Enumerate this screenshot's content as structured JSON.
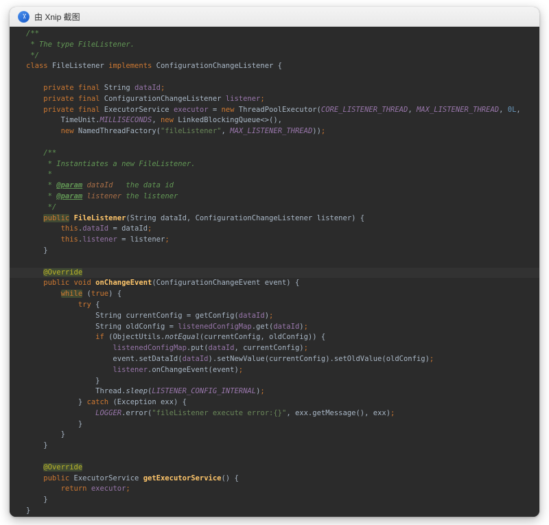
{
  "window": {
    "title": "由 Xnip 截图",
    "icon_glyph": "✂"
  },
  "theme": {
    "editor_background": "#2b2b2b",
    "titlebar_background": "#f4f4f4",
    "xnip_icon_blue": "#1659c8",
    "line_highlight": "#323232",
    "word_highlight": "#404a33",
    "default_text": "#a9b7c6",
    "keyword": "#cc7832",
    "string": "#6a8759",
    "number": "#6897bb",
    "comment": "#629755",
    "doc_tag_value": "#aa6f47",
    "field": "#9876aa",
    "method_decl": "#ffc66b",
    "annotation": "#bbb529"
  },
  "code": {
    "language": "java",
    "lines": [
      {
        "t": [
          [
            "c",
            "/**"
          ]
        ]
      },
      {
        "t": [
          [
            "c",
            " * The type FileListener."
          ]
        ]
      },
      {
        "t": [
          [
            "c",
            " */"
          ]
        ]
      },
      {
        "t": [
          [
            "k",
            "class"
          ],
          [
            "d",
            " FileListener "
          ],
          [
            "k",
            "implements"
          ],
          [
            "d",
            " ConfigurationChangeListener {"
          ]
        ]
      },
      {
        "t": []
      },
      {
        "t": [
          [
            "k",
            "    private final"
          ],
          [
            "d",
            " String "
          ],
          [
            "f",
            "dataId"
          ],
          [
            "k",
            ";"
          ]
        ]
      },
      {
        "t": [
          [
            "k",
            "    private final"
          ],
          [
            "d",
            " ConfigurationChangeListener "
          ],
          [
            "f",
            "listener"
          ],
          [
            "k",
            ";"
          ]
        ]
      },
      {
        "t": [
          [
            "k",
            "    private final"
          ],
          [
            "d",
            " ExecutorService "
          ],
          [
            "f",
            "executor"
          ],
          [
            "d",
            " = "
          ],
          [
            "k",
            "new"
          ],
          [
            "d",
            " ThreadPoolExecutor("
          ],
          [
            "sf",
            "CORE_LISTENER_THREAD"
          ],
          [
            "d",
            ", "
          ],
          [
            "sf",
            "MAX_LISTENER_THREAD"
          ],
          [
            "d",
            ", "
          ],
          [
            "n",
            "0L"
          ],
          [
            "d",
            ","
          ]
        ]
      },
      {
        "t": [
          [
            "d",
            "        TimeUnit."
          ],
          [
            "sf",
            "MILLISECONDS"
          ],
          [
            "d",
            ", "
          ],
          [
            "k",
            "new"
          ],
          [
            "d",
            " LinkedBlockingQueue<>(),"
          ]
        ]
      },
      {
        "t": [
          [
            "k",
            "        new"
          ],
          [
            "d",
            " NamedThreadFactory("
          ],
          [
            "s",
            "\"fileListener\""
          ],
          [
            "d",
            ", "
          ],
          [
            "sf",
            "MAX_LISTENER_THREAD"
          ],
          [
            "d",
            "))"
          ],
          [
            "k",
            ";"
          ]
        ]
      },
      {
        "t": []
      },
      {
        "t": [
          [
            "c",
            "    /**"
          ]
        ]
      },
      {
        "t": [
          [
            "c",
            "     * Instantiates a new FileListener."
          ]
        ]
      },
      {
        "t": [
          [
            "c",
            "     *"
          ]
        ]
      },
      {
        "t": [
          [
            "c",
            "     * "
          ],
          [
            "ct",
            "@param"
          ],
          [
            "c",
            " "
          ],
          [
            "cv",
            "dataId"
          ],
          [
            "c",
            "   the data id"
          ]
        ]
      },
      {
        "t": [
          [
            "c",
            "     * "
          ],
          [
            "ct",
            "@param"
          ],
          [
            "c",
            " "
          ],
          [
            "cv",
            "listener"
          ],
          [
            "c",
            " the listener"
          ]
        ]
      },
      {
        "t": [
          [
            "c",
            "     */"
          ]
        ]
      },
      {
        "t": [
          [
            "d",
            "    "
          ],
          [
            "k hl",
            "public"
          ],
          [
            "d",
            " "
          ],
          [
            "m",
            "FileListener"
          ],
          [
            "d",
            "(String dataId, ConfigurationChangeListener listener) {"
          ]
        ]
      },
      {
        "t": [
          [
            "k",
            "        this"
          ],
          [
            "d",
            "."
          ],
          [
            "f",
            "dataId"
          ],
          [
            "d",
            " = dataId"
          ],
          [
            "k",
            ";"
          ]
        ]
      },
      {
        "t": [
          [
            "k",
            "        this"
          ],
          [
            "d",
            "."
          ],
          [
            "f",
            "listener"
          ],
          [
            "d",
            " = listener"
          ],
          [
            "k",
            ";"
          ]
        ]
      },
      {
        "t": [
          [
            "d",
            "    }"
          ]
        ]
      },
      {
        "t": []
      },
      {
        "hl": true,
        "t": [
          [
            "d",
            "    "
          ],
          [
            "a hl",
            "@Override"
          ]
        ]
      },
      {
        "t": [
          [
            "k",
            "    public void"
          ],
          [
            "d",
            " "
          ],
          [
            "m",
            "onChangeEvent"
          ],
          [
            "d",
            "(ConfigurationChangeEvent event) {"
          ]
        ]
      },
      {
        "t": [
          [
            "d",
            "        "
          ],
          [
            "k hl",
            "while"
          ],
          [
            "d",
            " ("
          ],
          [
            "k",
            "true"
          ],
          [
            "d",
            ") {"
          ]
        ]
      },
      {
        "t": [
          [
            "k",
            "            try"
          ],
          [
            "d",
            " {"
          ]
        ]
      },
      {
        "t": [
          [
            "d",
            "                String currentConfig = getConfig("
          ],
          [
            "f",
            "dataId"
          ],
          [
            "d",
            ")"
          ],
          [
            "k",
            ";"
          ]
        ]
      },
      {
        "t": [
          [
            "d",
            "                String oldConfig = "
          ],
          [
            "f",
            "listenedConfigMap"
          ],
          [
            "d",
            ".get("
          ],
          [
            "f",
            "dataId"
          ],
          [
            "d",
            ")"
          ],
          [
            "k",
            ";"
          ]
        ]
      },
      {
        "t": [
          [
            "k",
            "                if"
          ],
          [
            "d",
            " (ObjectUtils."
          ],
          [
            "sm",
            "notEqual"
          ],
          [
            "d",
            "(currentConfig, oldConfig)) {"
          ]
        ]
      },
      {
        "t": [
          [
            "d",
            "                    "
          ],
          [
            "f",
            "listenedConfigMap"
          ],
          [
            "d",
            ".put("
          ],
          [
            "f",
            "dataId"
          ],
          [
            "d",
            ", currentConfig)"
          ],
          [
            "k",
            ";"
          ]
        ]
      },
      {
        "t": [
          [
            "d",
            "                    event.setDataId("
          ],
          [
            "f",
            "dataId"
          ],
          [
            "d",
            ").setNewValue(currentConfig).setOldValue(oldConfig)"
          ],
          [
            "k",
            ";"
          ]
        ]
      },
      {
        "t": [
          [
            "d",
            "                    "
          ],
          [
            "f",
            "listener"
          ],
          [
            "d",
            ".onChangeEvent(event)"
          ],
          [
            "k",
            ";"
          ]
        ]
      },
      {
        "t": [
          [
            "d",
            "                }"
          ]
        ]
      },
      {
        "t": [
          [
            "d",
            "                Thread."
          ],
          [
            "sm",
            "sleep"
          ],
          [
            "d",
            "("
          ],
          [
            "sf",
            "LISTENER_CONFIG_INTERNAL"
          ],
          [
            "d",
            ")"
          ],
          [
            "k",
            ";"
          ]
        ]
      },
      {
        "t": [
          [
            "d",
            "            } "
          ],
          [
            "k",
            "catch"
          ],
          [
            "d",
            " (Exception exx) {"
          ]
        ]
      },
      {
        "t": [
          [
            "d",
            "                "
          ],
          [
            "sf",
            "LOGGER"
          ],
          [
            "d",
            ".error("
          ],
          [
            "s",
            "\"fileListener execute error:{}\""
          ],
          [
            "d",
            ", exx.getMessage(), exx)"
          ],
          [
            "k",
            ";"
          ]
        ]
      },
      {
        "t": [
          [
            "d",
            "            }"
          ]
        ]
      },
      {
        "t": [
          [
            "d",
            "        }"
          ]
        ]
      },
      {
        "t": [
          [
            "d",
            "    }"
          ]
        ]
      },
      {
        "t": []
      },
      {
        "t": [
          [
            "d",
            "    "
          ],
          [
            "a hl",
            "@Override"
          ]
        ]
      },
      {
        "t": [
          [
            "k",
            "    public"
          ],
          [
            "d",
            " ExecutorService "
          ],
          [
            "m",
            "getExecutorService"
          ],
          [
            "d",
            "() {"
          ]
        ]
      },
      {
        "t": [
          [
            "k",
            "        return"
          ],
          [
            "d",
            " "
          ],
          [
            "f",
            "executor"
          ],
          [
            "k",
            ";"
          ]
        ]
      },
      {
        "t": [
          [
            "d",
            "    }"
          ]
        ]
      },
      {
        "t": [
          [
            "d",
            "}"
          ]
        ]
      }
    ]
  }
}
